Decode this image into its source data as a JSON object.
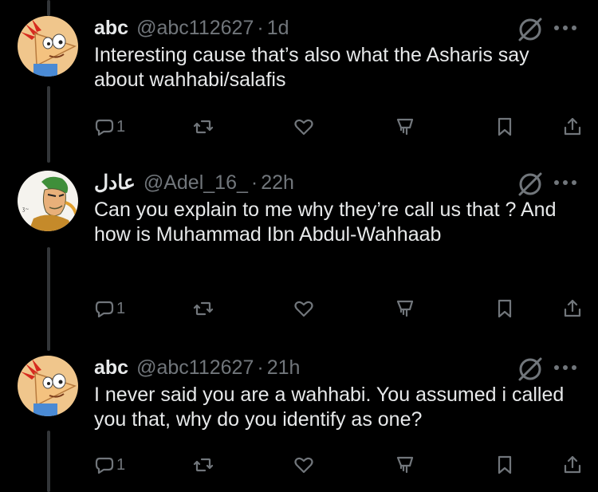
{
  "tweets": [
    {
      "name": "abc",
      "handle": "@abc112627",
      "separator": "·",
      "time": "1d",
      "text": "Interesting cause that’s also what the Asharis say about wahhabi/salafis",
      "reply_count": "1"
    },
    {
      "name": "عادل",
      "handle": "@Adel_16_",
      "separator": "·",
      "time": "22h",
      "text": "Can you explain to me why they’re call us that ? And how is Muhammad Ibn Abdul-Wahhaab",
      "reply_count": "1"
    },
    {
      "name": "abc",
      "handle": "@abc112627",
      "separator": "·",
      "time": "21h",
      "text": "I never said you are a wahhabi. You assumed i called you that, why do you identify as one?",
      "reply_count": "1"
    }
  ],
  "icons": {
    "reply": "reply-icon",
    "retweet": "retweet-icon",
    "like": "heart-icon",
    "stats": "views-icon",
    "bookmark": "bookmark-icon",
    "share": "share-icon",
    "blocked": "no-entry-icon",
    "more": "more-icon"
  },
  "colors": {
    "background": "#000000",
    "text": "#e7e9ea",
    "muted": "#71767b",
    "thread_line": "#333639"
  }
}
